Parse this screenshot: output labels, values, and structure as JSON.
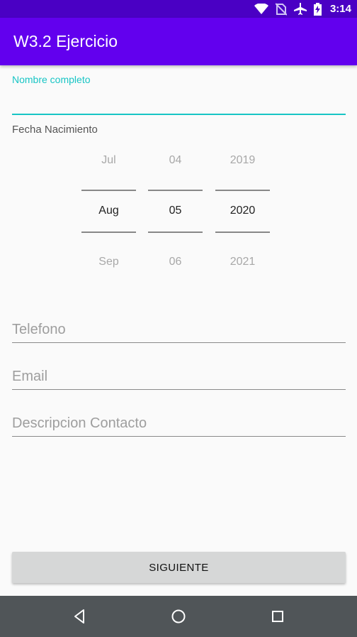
{
  "status_bar": {
    "time": "3:14",
    "icons": [
      "wifi-icon",
      "no-sim-icon",
      "airplane-mode-icon",
      "battery-charging-icon"
    ]
  },
  "app_bar": {
    "title": "W3.2 Ejercicio"
  },
  "form": {
    "full_name_label": "Nombre completo",
    "birth_date_label": "Fecha Nacimiento",
    "date_picker": {
      "month": {
        "prev": "Jul",
        "current": "Aug",
        "next": "Sep"
      },
      "day": {
        "prev": "04",
        "current": "05",
        "next": "06"
      },
      "year": {
        "prev": "2019",
        "current": "2020",
        "next": "2021"
      }
    },
    "phone_placeholder": "Telefono",
    "email_placeholder": "Email",
    "description_placeholder": "Descripcion Contacto",
    "next_button": "SIGUIENTE"
  },
  "colors": {
    "status_bar": "#4a00c4",
    "app_bar": "#6200ee",
    "accent": "#18c5c5",
    "nav_bar": "#505558"
  },
  "nav_bar": {
    "buttons": [
      "back-icon",
      "home-icon",
      "recents-icon"
    ]
  }
}
